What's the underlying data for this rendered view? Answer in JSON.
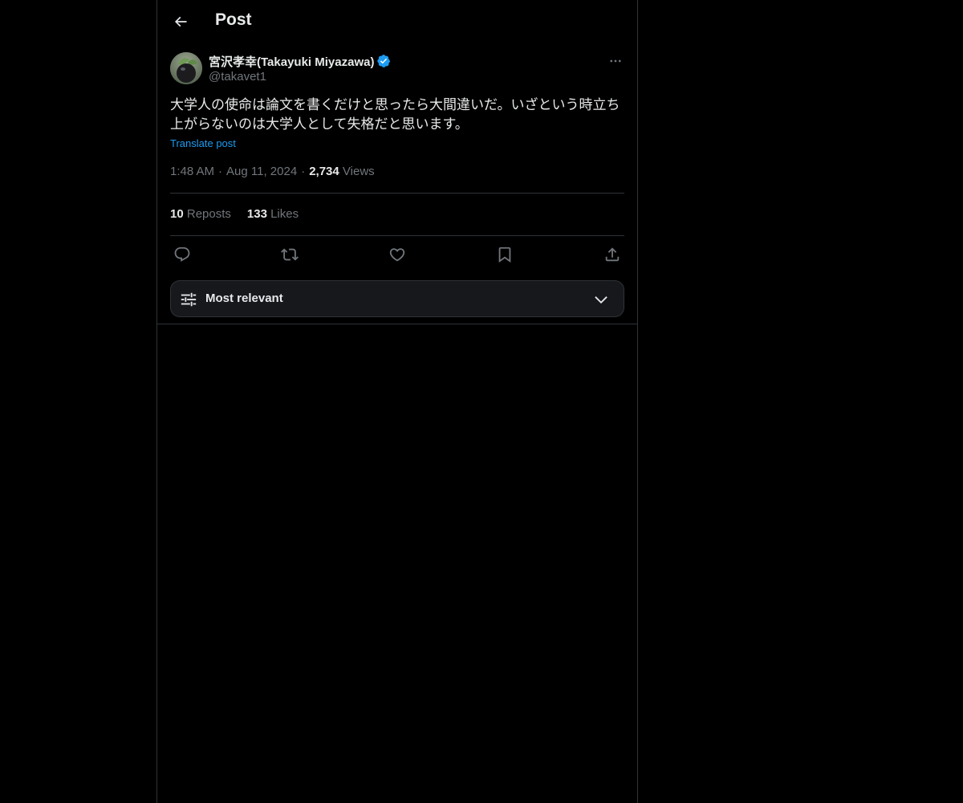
{
  "header": {
    "title": "Post"
  },
  "post": {
    "author": {
      "name": "宮沢孝幸(Takayuki Miyazawa)",
      "handle": "@takavet1",
      "verified": true
    },
    "text": "大学人の使命は論文を書くだけと思ったら大間違いだ。いざという時立ち上がらないのは大学人として失格だと思います。",
    "translate_label": "Translate post",
    "time": "1:48 AM",
    "date": "Aug 11, 2024",
    "views_count": "2,734",
    "views_label": "Views",
    "reposts_count": "10",
    "reposts_label": "Reposts",
    "likes_count": "133",
    "likes_label": "Likes"
  },
  "sort": {
    "label": "Most relevant"
  },
  "colors": {
    "background": "#000000",
    "text": "#e7e9ea",
    "muted": "#71767b",
    "accent": "#1d9bf0",
    "border": "#2f3336"
  },
  "icons": {
    "back": "arrow-left-icon",
    "verified": "verified-badge-icon",
    "more": "more-icon",
    "reply": "reply-icon",
    "repost": "repost-icon",
    "like": "heart-icon",
    "bookmark": "bookmark-icon",
    "share": "share-icon",
    "sort": "sliders-icon",
    "chevron": "chevron-down-icon"
  }
}
